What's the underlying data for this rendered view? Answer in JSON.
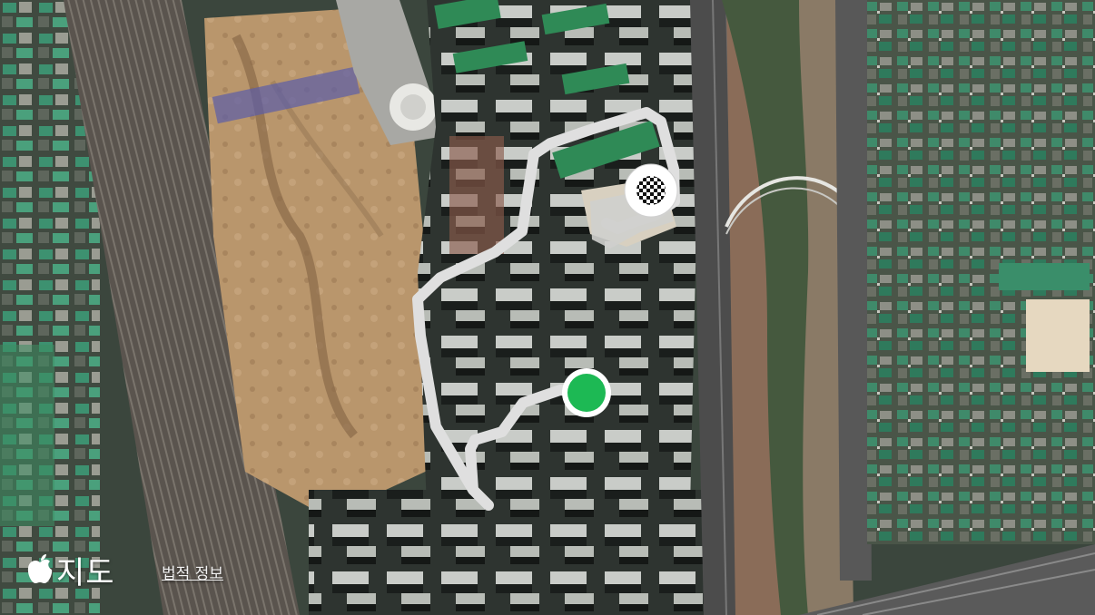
{
  "map": {
    "type": "satellite",
    "route_color": "#e2e2e2",
    "start_marker_color": "#1db954",
    "finish_marker_icon": "checkered-flag-icon"
  },
  "attribution": {
    "logo_text": "지도",
    "logo_icon": "apple-logo-icon",
    "legal_link": "법적 정보"
  }
}
